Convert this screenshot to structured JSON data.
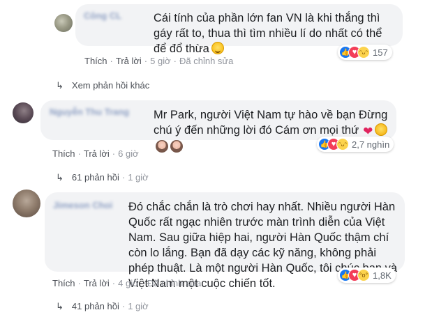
{
  "comments": [
    {
      "author": "Công CL",
      "text": "Cái tính của phần lớn fan VN là khi thắng thì gáy rất to, thua thì tìm nhiều lí do nhất có thể để đổ thừa",
      "reaction_count": "157",
      "like_label": "Thích",
      "reply_label": "Trả lời",
      "time": "5 giờ",
      "edited_label": "Đã chỉnh sửa",
      "replies_link": "Xem phản hồi khác"
    },
    {
      "author": "Nguyễn Thu Trang",
      "text": "Mr Park, người Việt Nam tự hào về bạn  Đừng chú ý đến những lời đó  Cám ơn mọi thứ",
      "reaction_count": "2,7 nghìn",
      "like_label": "Thích",
      "reply_label": "Trả lời",
      "time": "6 giờ",
      "replies_link": "61 phản hồi",
      "replies_time": "1 giờ"
    },
    {
      "author": "Jimeson Choi",
      "text": "Đó chắc chắn là trò chơi hay nhất. Nhiều người Hàn Quốc rất ngạc nhiên trước màn trình diễn của Việt Nam. Sau giữa hiệp hai, người Hàn Quốc thậm chí còn lo lắng. Bạn đã dạy các kỹ năng, không phải phép thuật. Là một người Hàn Quốc, tôi chúc bạn và Việt Nam một cuộc chiến tốt.",
      "reaction_count": "1,8K",
      "like_label": "Thích",
      "reply_label": "Trả lời",
      "time": "4 giờ",
      "edited_label": "Đã chỉnh sửa",
      "replies_link": "41 phản hồi",
      "replies_time": "1 giờ"
    }
  ],
  "separator": "·",
  "reply_arrow": "↳",
  "icons": {
    "like": "like-icon",
    "love": "love-icon",
    "haha": "haha-icon",
    "wow": "wow-icon"
  },
  "colors": {
    "bubble": "#f2f3f5",
    "link": "#4b4f56",
    "like_blue": "#1877f2",
    "love_red": "#f33e58"
  }
}
